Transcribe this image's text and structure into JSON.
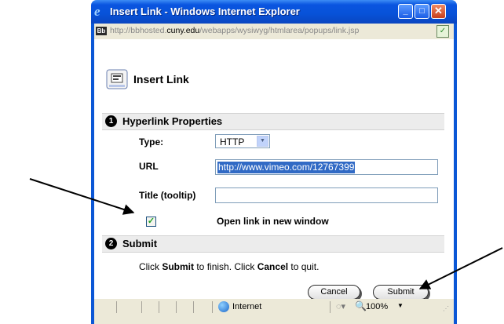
{
  "window": {
    "title": "Insert Link - Windows Internet Explorer",
    "url_prefix": "http://bbhosted.",
    "url_domain": "cuny.edu",
    "url_suffix": "/webapps/wysiwyg/htmlarea/popups/link.jsp"
  },
  "page": {
    "title": "Insert Link"
  },
  "sections": [
    {
      "number": "1",
      "title": "Hyperlink Properties"
    },
    {
      "number": "2",
      "title": "Submit"
    }
  ],
  "form": {
    "type_label": "Type:",
    "type_value": "HTTP",
    "url_label": "URL",
    "url_value": "http://www.vimeo.com/12767399",
    "title_label": "Title (tooltip)",
    "title_value": "",
    "open_new_window_label": "Open link in new window",
    "open_new_window_checked": true
  },
  "submit": {
    "info_pre": "Click ",
    "info_submit": "Submit",
    "info_mid": " to finish. Click ",
    "info_cancel": "Cancel",
    "info_post": " to quit.",
    "cancel_label": "Cancel",
    "submit_label": "Submit"
  },
  "statusbar": {
    "zone": "Internet",
    "zoom": "100%"
  },
  "icons": {
    "ie": "ie-logo-icon",
    "site": "bb-site-icon",
    "verify": "verify-icon",
    "page": "insert-link-icon",
    "globe": "internet-zone-globe-icon",
    "protected": "protected-mode-icon",
    "zoom": "zoom-icon",
    "grip": "resize-grip-icon"
  },
  "colors": {
    "titlebar": "#0a55e0",
    "close": "#c8401c",
    "selection": "#316ac5",
    "checkmark": "#21a121"
  }
}
